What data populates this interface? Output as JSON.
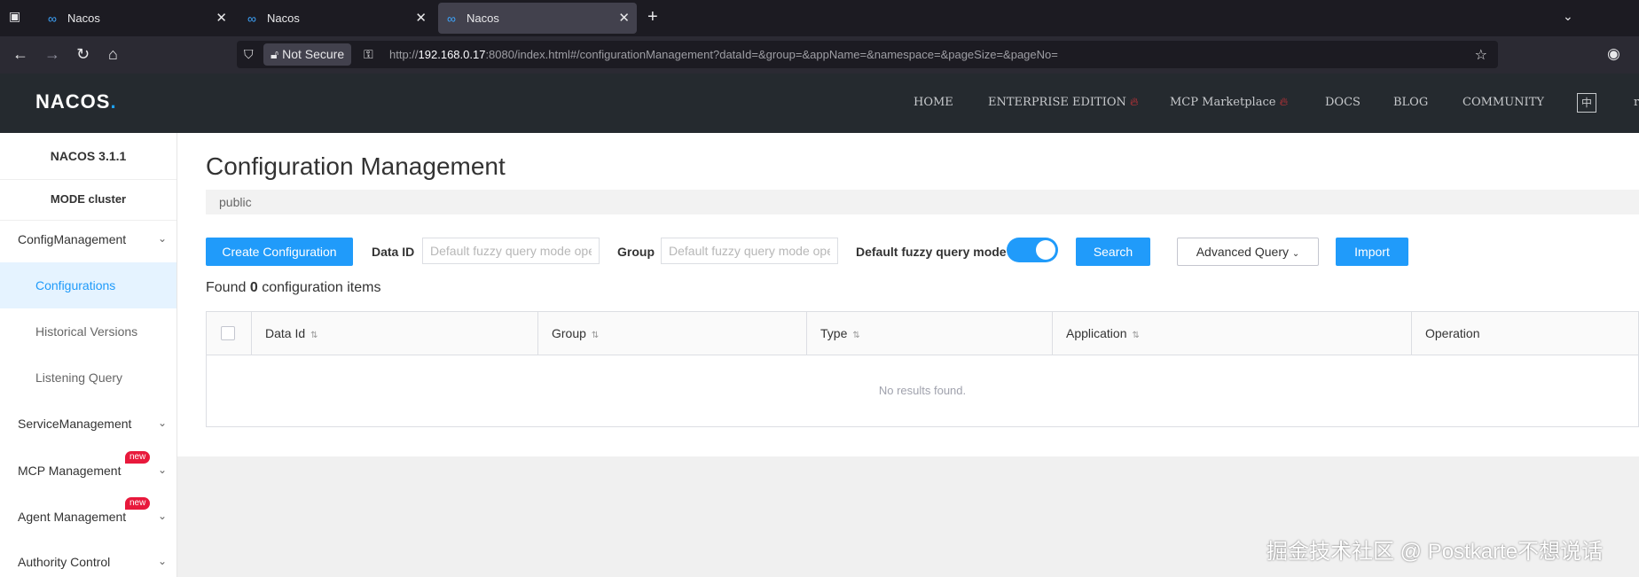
{
  "browser": {
    "tabs": [
      {
        "title": "Nacos",
        "active": false
      },
      {
        "title": "Nacos",
        "active": false
      },
      {
        "title": "Nacos",
        "active": true
      }
    ],
    "security_label": "Not Secure",
    "url_prefix": "http://",
    "url_host": "192.168.0.17",
    "url_rest": ":8080/index.html#/configurationManagement?dataId=&group=&appName=&namespace=&pageSize=&pageNo="
  },
  "header": {
    "logo": "NACOS",
    "logo_dot": ".",
    "nav": [
      "HOME",
      "ENTERPRISE EDITION",
      "MCP Marketplace",
      "DOCS",
      "BLOG",
      "COMMUNITY"
    ],
    "lang_toggle": "中",
    "cut_off": "r"
  },
  "sidebar": {
    "version": "NACOS 3.1.1",
    "mode": "MODE cluster",
    "groups": [
      {
        "label": "ConfigManagement"
      },
      {
        "label": "ServiceManagement"
      },
      {
        "label": "MCP Management",
        "badge": "new"
      },
      {
        "label": "Agent Management",
        "badge": "new"
      },
      {
        "label": "Authority Control"
      }
    ],
    "config_items": [
      "Configurations",
      "Historical Versions",
      "Listening Query"
    ],
    "active_item": "Configurations"
  },
  "main": {
    "title": "Configuration Management",
    "namespace": "public",
    "create_button": "Create Configuration",
    "data_id_label": "Data ID",
    "data_id_placeholder": "Default fuzzy query mode ope",
    "group_label": "Group",
    "group_placeholder": "Default fuzzy query mode ope",
    "fuzzy_label": "Default fuzzy query mode",
    "fuzzy_enabled": true,
    "search_button": "Search",
    "advanced_button": "Advanced Query",
    "import_button": "Import",
    "found_prefix": "Found",
    "found_count": "0",
    "found_suffix": "configuration items",
    "columns": [
      "Data Id",
      "Group",
      "Type",
      "Application",
      "Operation"
    ],
    "empty_text": "No results found."
  },
  "watermark": "掘金技术社区 @ Postkarte不想说话",
  "colors": {
    "primary": "#209bfa",
    "header_bg": "#252a2f",
    "badge": "#e8193c"
  }
}
